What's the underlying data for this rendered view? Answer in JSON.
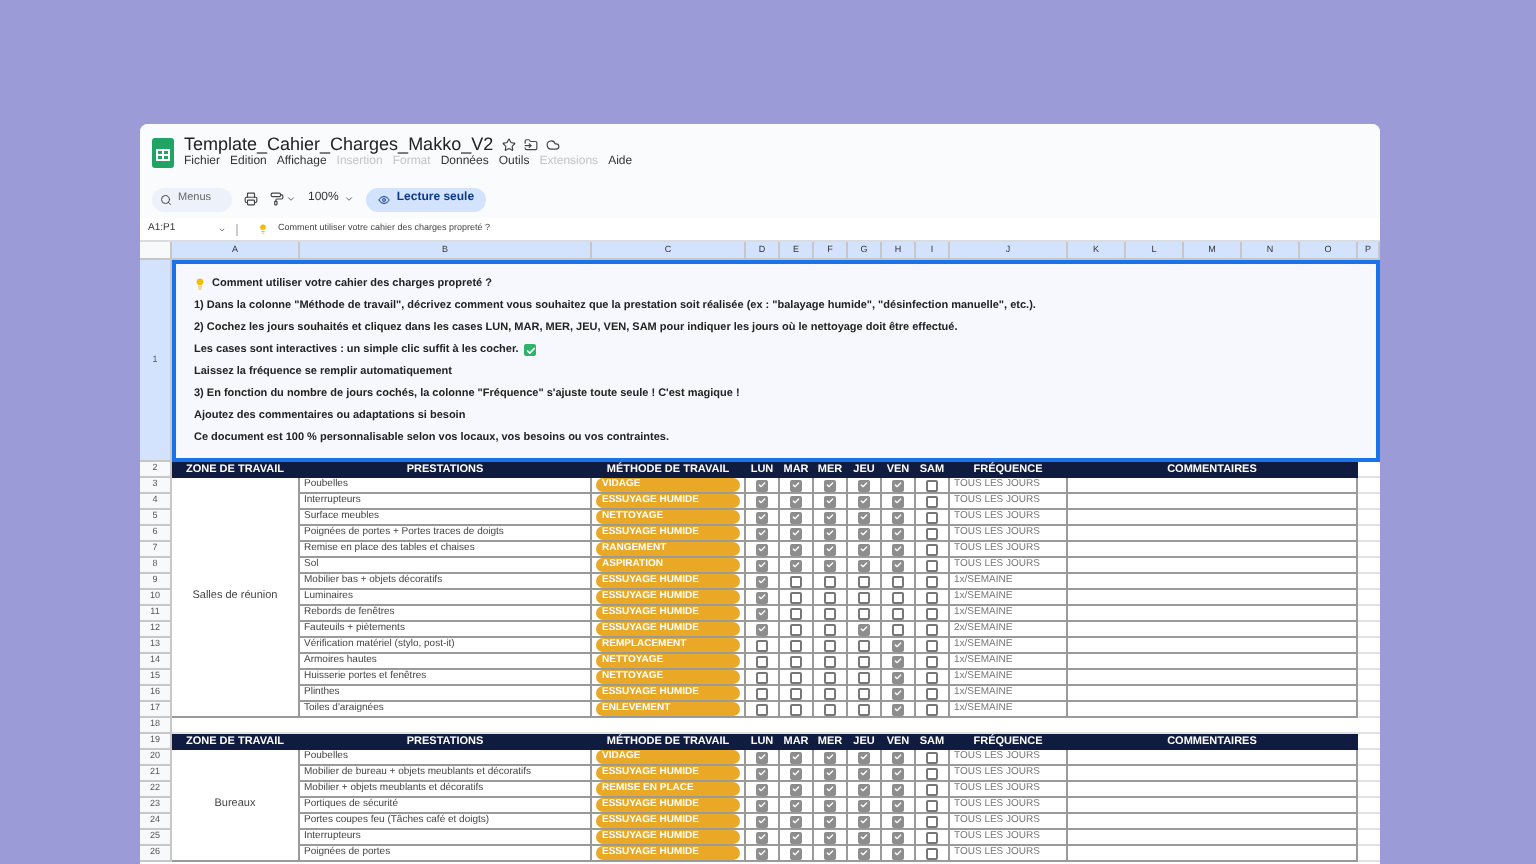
{
  "document": {
    "title": "Template_Cahier_Charges_Makko_V2",
    "menus": [
      {
        "label": "Fichier",
        "disabled": false
      },
      {
        "label": "Edition",
        "disabled": false
      },
      {
        "label": "Affichage",
        "disabled": false
      },
      {
        "label": "Insertion",
        "disabled": true
      },
      {
        "label": "Format",
        "disabled": true
      },
      {
        "label": "Données",
        "disabled": false
      },
      {
        "label": "Outils",
        "disabled": false
      },
      {
        "label": "Extensions",
        "disabled": true
      },
      {
        "label": "Aide",
        "disabled": false
      }
    ]
  },
  "toolbar": {
    "search_placeholder": "Menus",
    "zoom": "100%",
    "mode_button": "Lecture seule"
  },
  "formula_bar": {
    "cell_ref": "A1:P1",
    "content": "Comment utiliser votre cahier des charges propreté ?"
  },
  "columns": [
    "A",
    "B",
    "C",
    "D",
    "E",
    "F",
    "G",
    "H",
    "I",
    "J",
    "K",
    "L",
    "M",
    "N",
    "O",
    "P"
  ],
  "intro": {
    "row_number": "1",
    "title": "Comment utiliser votre cahier des charges propreté ?",
    "lines_before": [
      "1) Dans la colonne \"Méthode de travail\", décrivez comment vous souhaitez que la prestation soit réalisée (ex : \"balayage humide\", \"désinfection manuelle\", etc.).",
      "2) Cochez les jours souhaités et cliquez dans les cases LUN, MAR, MER, JEU, VEN, SAM pour indiquer les jours où le nettoyage doit être effectué."
    ],
    "checkbox_hint": "Les cases sont interactives : un simple clic suffit à les cocher.",
    "lines_after": [
      "Laissez la fréquence se remplir automatiquement",
      "3) En fonction du nombre de jours cochés, la colonne \"Fréquence\" s'ajuste toute seule ! C'est magique !",
      "Ajoutez des commentaires ou adaptations si besoin",
      "Ce document est 100 % personnalisable selon vos locaux, vos besoins ou vos contraintes."
    ]
  },
  "sections": [
    {
      "header_row": "2",
      "headers": {
        "zone": "ZONE DE TRAVAIL",
        "prestations": "PRESTATIONS",
        "method": "MÉTHODE DE TRAVAIL",
        "days": [
          "LUN",
          "MAR",
          "MER",
          "JEU",
          "VEN",
          "SAM"
        ],
        "frequency": "FRÉQUENCE",
        "comments": "COMMENTAIRES"
      },
      "zone": "Salles de réunion",
      "rows": [
        {
          "row_number": "3",
          "prestation": "Poubelles",
          "method": "VIDAGE",
          "checks": [
            true,
            true,
            true,
            true,
            true,
            false
          ],
          "frequency": "TOUS LES JOURS"
        },
        {
          "row_number": "4",
          "prestation": "Interrupteurs",
          "method": "ESSUYAGE HUMIDE",
          "checks": [
            true,
            true,
            true,
            true,
            true,
            false
          ],
          "frequency": "TOUS LES JOURS"
        },
        {
          "row_number": "5",
          "prestation": "Surface meubles",
          "method": "NETTOYAGE",
          "checks": [
            true,
            true,
            true,
            true,
            true,
            false
          ],
          "frequency": "TOUS LES JOURS"
        },
        {
          "row_number": "6",
          "prestation": "Poignées de portes + Portes traces de doigts",
          "method": "ESSUYAGE HUMIDE",
          "checks": [
            true,
            true,
            true,
            true,
            true,
            false
          ],
          "frequency": "TOUS LES JOURS"
        },
        {
          "row_number": "7",
          "prestation": "Remise en place des tables et chaises",
          "method": "RANGEMENT",
          "checks": [
            true,
            true,
            true,
            true,
            true,
            false
          ],
          "frequency": "TOUS LES JOURS"
        },
        {
          "row_number": "8",
          "prestation": "Sol",
          "method": "ASPIRATION",
          "checks": [
            true,
            true,
            true,
            true,
            true,
            false
          ],
          "frequency": "TOUS LES JOURS"
        },
        {
          "row_number": "9",
          "prestation": "Mobilier bas + objets décoratifs",
          "method": "ESSUYAGE HUMIDE",
          "checks": [
            true,
            false,
            false,
            false,
            false,
            false
          ],
          "frequency": "1x/SEMAINE"
        },
        {
          "row_number": "10",
          "prestation": "Luminaires",
          "method": "ESSUYAGE HUMIDE",
          "checks": [
            true,
            false,
            false,
            false,
            false,
            false
          ],
          "frequency": "1x/SEMAINE"
        },
        {
          "row_number": "11",
          "prestation": "Rebords de fenêtres",
          "method": "ESSUYAGE HUMIDE",
          "checks": [
            true,
            false,
            false,
            false,
            false,
            false
          ],
          "frequency": "1x/SEMAINE"
        },
        {
          "row_number": "12",
          "prestation": "Fauteuils + piètements",
          "method": "ESSUYAGE HUMIDE",
          "checks": [
            true,
            false,
            false,
            true,
            false,
            false
          ],
          "frequency": "2x/SEMAINE"
        },
        {
          "row_number": "13",
          "prestation": "Vérification matériel (stylo, post-it)",
          "method": "REMPLACEMENT",
          "checks": [
            false,
            false,
            false,
            false,
            true,
            false
          ],
          "frequency": "1x/SEMAINE"
        },
        {
          "row_number": "14",
          "prestation": "Armoires hautes",
          "method": "NETTOYAGE",
          "checks": [
            false,
            false,
            false,
            false,
            true,
            false
          ],
          "frequency": "1x/SEMAINE"
        },
        {
          "row_number": "15",
          "prestation": "Huisserie portes et fenêtres",
          "method": "NETTOYAGE",
          "checks": [
            false,
            false,
            false,
            false,
            true,
            false
          ],
          "frequency": "1x/SEMAINE"
        },
        {
          "row_number": "16",
          "prestation": "Plinthes",
          "method": "ESSUYAGE HUMIDE",
          "checks": [
            false,
            false,
            false,
            false,
            true,
            false
          ],
          "frequency": "1x/SEMAINE"
        },
        {
          "row_number": "17",
          "prestation": "Toiles d'araignées",
          "method": "ENLEVEMENT",
          "checks": [
            false,
            false,
            false,
            false,
            true,
            false
          ],
          "frequency": "1x/SEMAINE"
        }
      ],
      "spacer_row": "18"
    },
    {
      "header_row": "19",
      "headers": {
        "zone": "ZONE DE TRAVAIL",
        "prestations": "PRESTATIONS",
        "method": "MÉTHODE DE TRAVAIL",
        "days": [
          "LUN",
          "MAR",
          "MER",
          "JEU",
          "VEN",
          "SAM"
        ],
        "frequency": "FRÉQUENCE",
        "comments": "COMMENTAIRES"
      },
      "zone": "Bureaux",
      "rows": [
        {
          "row_number": "20",
          "prestation": "Poubelles",
          "method": "VIDAGE",
          "checks": [
            true,
            true,
            true,
            true,
            true,
            false
          ],
          "frequency": "TOUS LES JOURS"
        },
        {
          "row_number": "21",
          "prestation": "Mobilier de bureau + objets meublants et décoratifs",
          "method": "ESSUYAGE HUMIDE",
          "checks": [
            true,
            true,
            true,
            true,
            true,
            false
          ],
          "frequency": "TOUS LES JOURS"
        },
        {
          "row_number": "22",
          "prestation": "Mobilier + objets meublants et décoratifs",
          "method": "REMISE EN PLACE",
          "checks": [
            true,
            true,
            true,
            true,
            true,
            false
          ],
          "frequency": "TOUS LES JOURS"
        },
        {
          "row_number": "23",
          "prestation": "Portiques de sécurité",
          "method": "ESSUYAGE HUMIDE",
          "checks": [
            true,
            true,
            true,
            true,
            true,
            false
          ],
          "frequency": "TOUS LES JOURS"
        },
        {
          "row_number": "24",
          "prestation": "Portes coupes feu (Tâches café et doigts)",
          "method": "ESSUYAGE HUMIDE",
          "checks": [
            true,
            true,
            true,
            true,
            true,
            false
          ],
          "frequency": "TOUS LES JOURS"
        },
        {
          "row_number": "25",
          "prestation": "Interrupteurs",
          "method": "ESSUYAGE HUMIDE",
          "checks": [
            true,
            true,
            true,
            true,
            true,
            false
          ],
          "frequency": "TOUS LES JOURS"
        },
        {
          "row_number": "26",
          "prestation": "Poignées de portes",
          "method": "ESSUYAGE HUMIDE",
          "checks": [
            true,
            true,
            true,
            true,
            true,
            false
          ],
          "frequency": "TOUS LES JOURS"
        }
      ]
    }
  ]
}
